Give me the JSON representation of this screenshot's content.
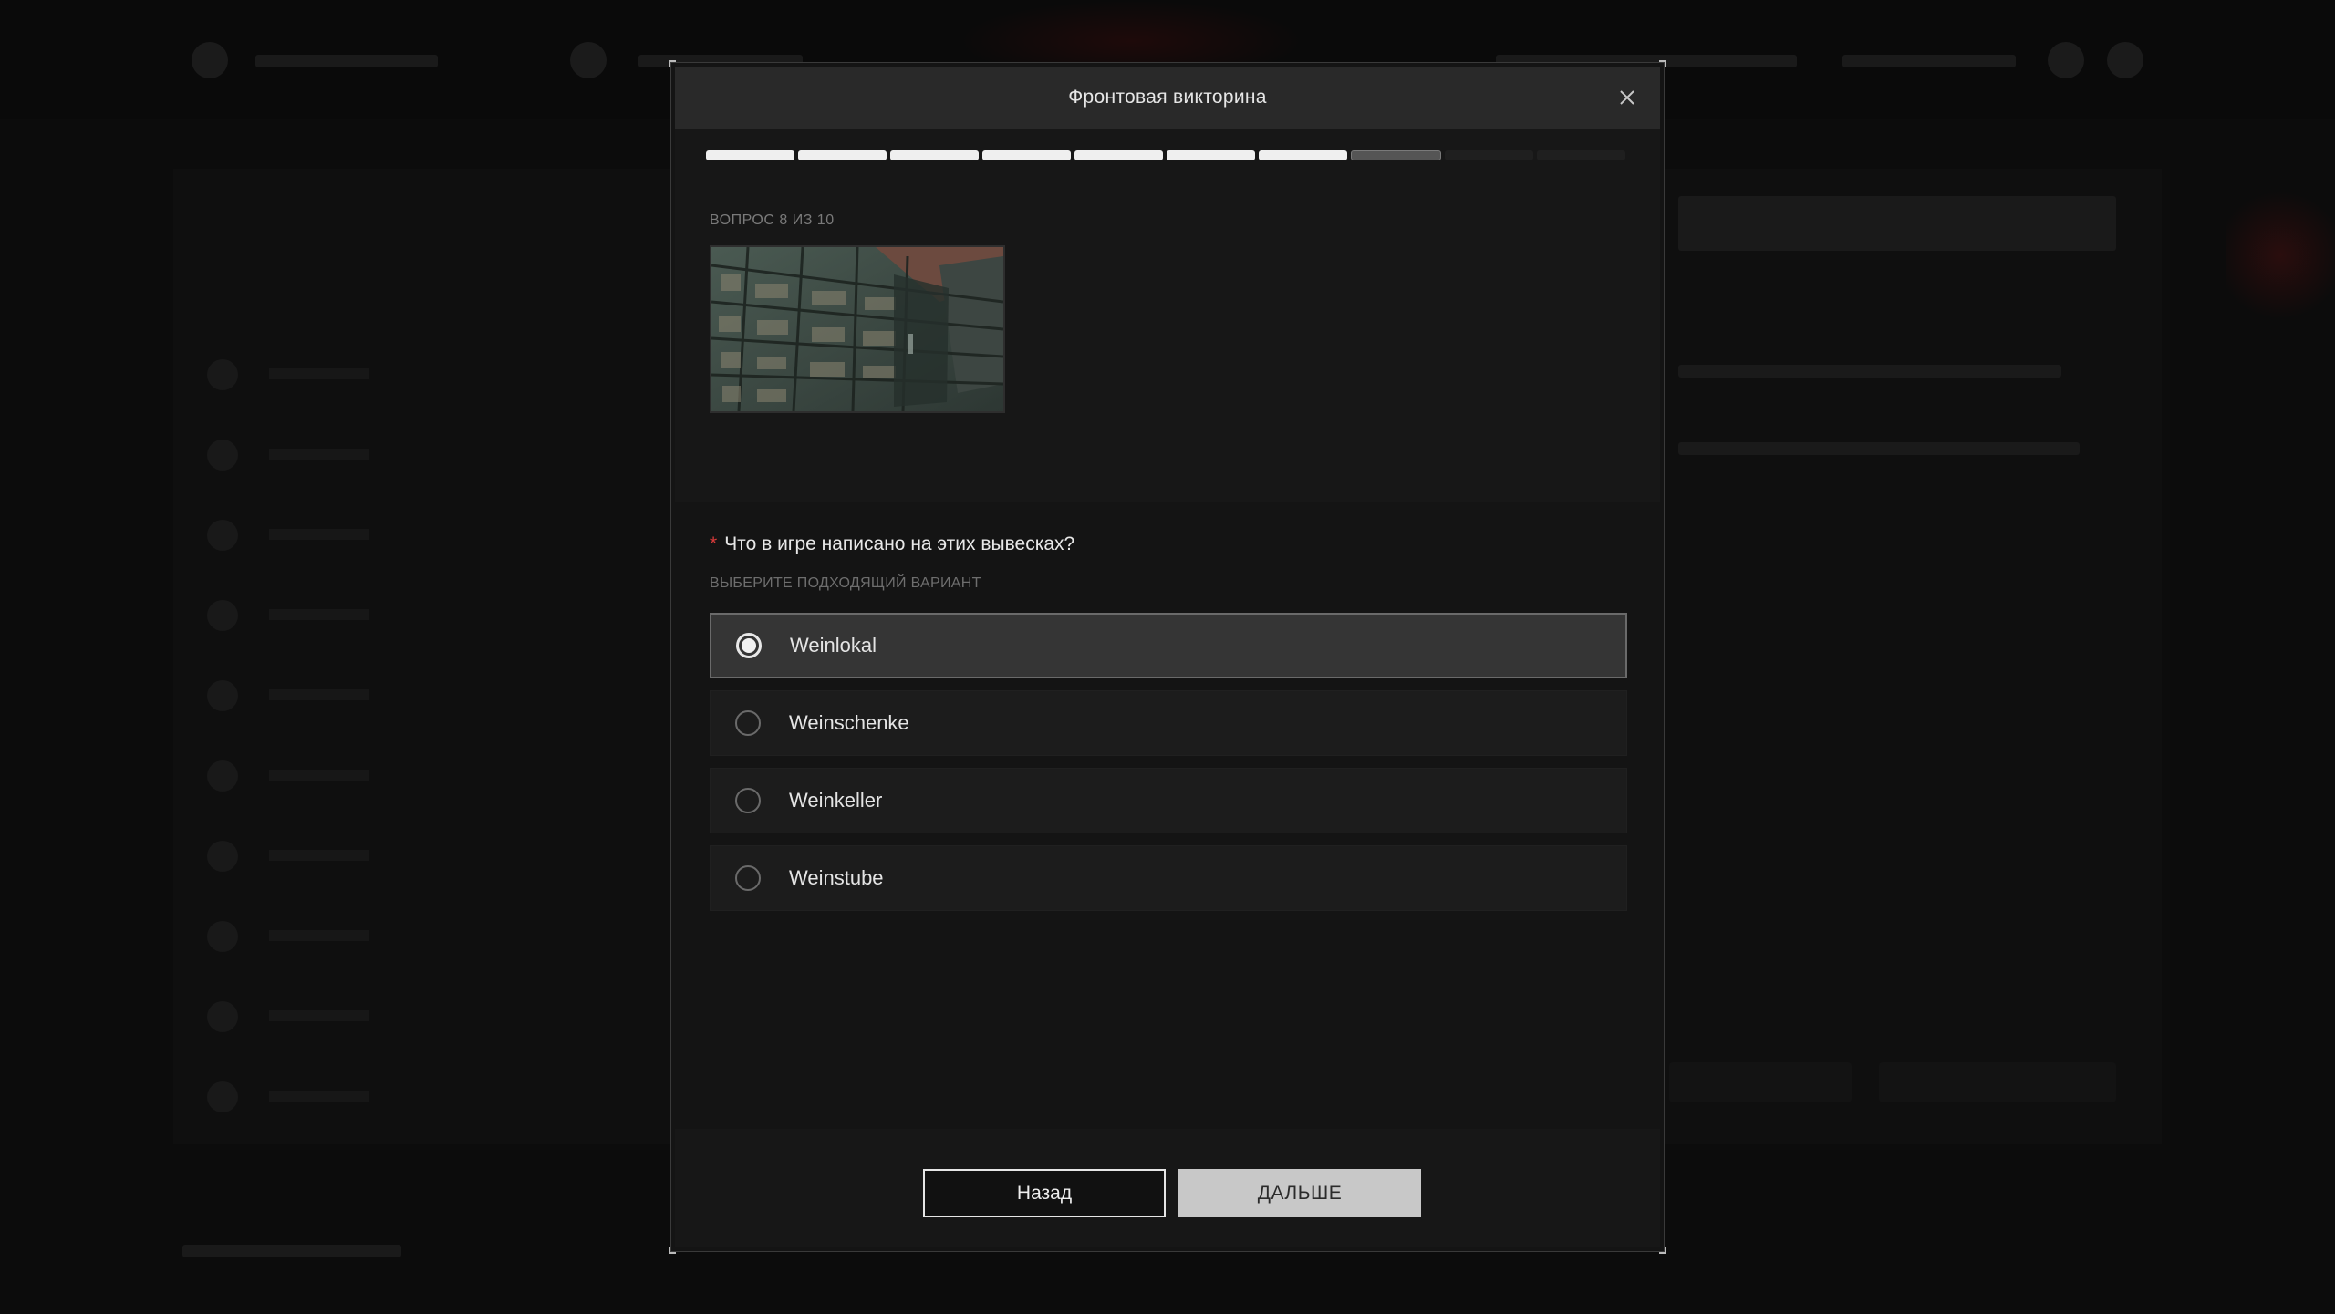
{
  "modal": {
    "title": "Фронтовая викторина",
    "progress": {
      "total": 10,
      "completed": 7,
      "current": 8
    },
    "question_counter": "ВОПРОС 8 ИЗ 10",
    "required_mark": "*",
    "question": "Что в игре написано на этих вывесках?",
    "hint": "ВЫБЕРИТЕ ПОДХОДЯЩИЙ ВАРИАНТ",
    "options": [
      {
        "label": "Weinlokal",
        "selected": true
      },
      {
        "label": "Weinschenke",
        "selected": false
      },
      {
        "label": "Weinkeller",
        "selected": false
      },
      {
        "label": "Weinstube",
        "selected": false
      }
    ],
    "buttons": {
      "back": "Назад",
      "next": "ДАЛЬШЕ"
    }
  },
  "icons": {
    "close": "close-icon",
    "radio": "radio-icon"
  }
}
